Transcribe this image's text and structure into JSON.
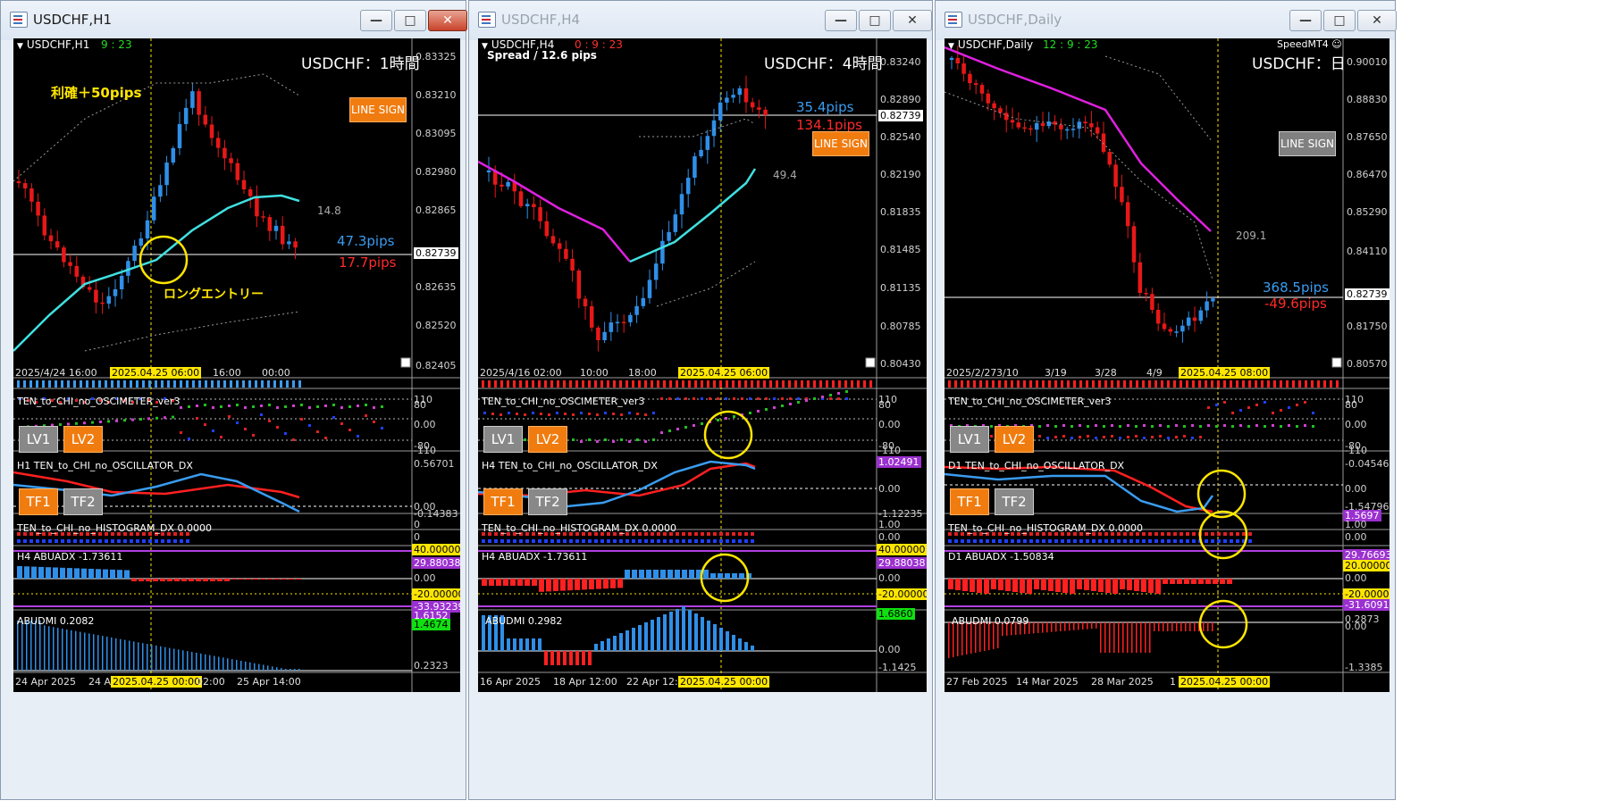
{
  "windows": [
    {
      "title": "USDCHF,H1",
      "active": true,
      "symbol": "USDCHF,H1",
      "timer": "9 : 23",
      "timer_color": "#22dd22",
      "chart_title": "USDCHF：1時間",
      "pips_blue": "47.3pips",
      "pips_red": "17.7pips",
      "line_sign": "LINE SIGN",
      "line_sign_style": "orange",
      "mid_value": "14.8",
      "prices": [
        "0.83325",
        "0.83210",
        "0.83095",
        "0.82980",
        "0.82865",
        "0.82739",
        "0.82635",
        "0.82520",
        "0.82405"
      ],
      "current_price": "0.82739",
      "times": [
        "2025/4/24 16:00",
        "2025.04.25 06:00",
        "16:00",
        "00:00"
      ],
      "osc_title": "TEN_to_CHI_no_OSCIMETER_ver3",
      "osc_levels": [
        "110",
        "80",
        "0.00",
        "-80",
        "-110"
      ],
      "lv1": "LV1",
      "lv2": "LV2",
      "dx_title": "H1 TEN_to_CHI_no_OSCILLATOR_DX",
      "dx_levels": [
        "0.56701",
        "0.00",
        "-0.14383"
      ],
      "tf1": "TF1",
      "tf2": "TF2",
      "hist_title": "TEN_to_CHI_no_HISTOGRAM_DX 0.0000",
      "hist_levels": [
        "0",
        "0"
      ],
      "adx_title": "H4 ABUADX -1.73611",
      "adx_levels": [
        "40.00000",
        "29.88038",
        "0.00",
        "-20.00000",
        "-33.93239"
      ],
      "dmi_title": "ABUDMI 0.2082",
      "dmi_levels": [
        "1.6152",
        "1.4674",
        "0.2323"
      ],
      "bottom_times": [
        "24 Apr 2025",
        "24 A",
        "2025.04.25 00:00",
        "02:00",
        "25 Apr 14:00"
      ],
      "annotation_take_profit": "利確＋50pips",
      "annotation_entry": "ロングエントリー"
    },
    {
      "title": "USDCHF,H4",
      "active": false,
      "symbol": "USDCHF,H4",
      "timer": "0 : 9 : 23",
      "timer_color": "#ff3030",
      "spread": "Spread / 12.6 pips",
      "chart_title": "USDCHF：4時間",
      "pips_blue": "35.4pips",
      "pips_red": "134.1pips",
      "line_sign": "LINE SIGN",
      "line_sign_style": "orange",
      "mid_value": "49.4",
      "prices": [
        "0.83240",
        "0.82890",
        "0.82739",
        "0.82540",
        "0.82190",
        "0.81835",
        "0.81485",
        "0.81135",
        "0.80785",
        "0.80430"
      ],
      "current_price": "0.82739",
      "times": [
        "2025/4/16 02:00",
        "10:00",
        "18:00",
        "2025.04.25 06:00"
      ],
      "osc_title": "TEN_to_CHI_no_OSCIMETER_ver3",
      "osc_levels": [
        "110",
        "80",
        "0.00",
        "-80",
        "-110"
      ],
      "lv1": "LV1",
      "lv2": "LV2",
      "dx_title": "H4 TEN_to_CHI_no_OSCILLATOR_DX",
      "dx_levels": [
        "1.02491",
        "0.00",
        "-1.12235"
      ],
      "tf1": "TF1",
      "tf2": "TF2",
      "hist_title": "TEN_to_CHI_no_HISTOGRAM_DX 0.0000",
      "hist_levels": [
        "1.00",
        "0.00"
      ],
      "adx_title": "H4 ABUADX -1.73611",
      "adx_levels": [
        "40.00000",
        "29.88038",
        "0.00",
        "-20.00000"
      ],
      "dmi_title": "ABUDMI 0.2982",
      "dmi_levels": [
        "1.6860",
        "0.00",
        "-1.1425"
      ],
      "bottom_times": [
        "16 Apr 2025",
        "18 Apr 12:00",
        "22 Apr 12:0",
        "2025.04.25 00:00"
      ]
    },
    {
      "title": "USDCHF,Daily",
      "active": false,
      "symbol": "USDCHF,Daily",
      "timer": "12 : 9 : 23",
      "timer_color": "#22dd22",
      "speed": "SpeedMT4 ☺",
      "chart_title": "USDCHF：日",
      "pips_blue": "368.5pips",
      "pips_red": "-49.6pips",
      "line_sign": "LINE SIGN",
      "line_sign_style": "gray",
      "mid_value": "209.1",
      "prices": [
        "0.90010",
        "0.88830",
        "0.87650",
        "0.86470",
        "0.85290",
        "0.84110",
        "0.82739",
        "0.81750",
        "0.80570"
      ],
      "current_price": "0.82739",
      "times": [
        "2025/2/27",
        "3/10",
        "3/19",
        "3/28",
        "4/9",
        "2025.04.25 08:00"
      ],
      "osc_title": "TEN_to_CHI_no_OSCIMETER_ver3",
      "osc_levels": [
        "110",
        "80",
        "0.00",
        "-80",
        "-110"
      ],
      "lv1": "LV1",
      "lv2": "LV2",
      "dx_title": "D1 TEN_to_CHI_no_OSCILLATOR_DX",
      "dx_levels": [
        "-0.04546",
        "0.00",
        "-1.54796",
        "1.5697"
      ],
      "tf1": "TF1",
      "tf2": "TF2",
      "hist_title": "TEN_to_CHI_no_HISTOGRAM_DX 0.0000",
      "hist_levels": [
        "1.00",
        "0.00"
      ],
      "adx_title": "D1 ABUADX -1.50834",
      "adx_levels": [
        "29.76693",
        "20.00000",
        "0.00",
        "-20.00000",
        "-31.60913"
      ],
      "dmi_title": "ABUDMI 0.0799",
      "dmi_levels": [
        "0.2873",
        "0.00",
        "-1.3385"
      ],
      "bottom_times": [
        "27 Feb 2025",
        "14 Mar 2025",
        "28 Mar 2025",
        "1",
        "2025.04.25 00:00"
      ]
    }
  ],
  "controls": {
    "minimize": "—",
    "maximize": "□",
    "close": "✕"
  },
  "colors": {
    "bull": "#2f8fe8",
    "bear": "#e81818",
    "ma_cyan": "#40e0e0",
    "ma_magenta": "#e020e0",
    "highlight": "#ffe600"
  }
}
